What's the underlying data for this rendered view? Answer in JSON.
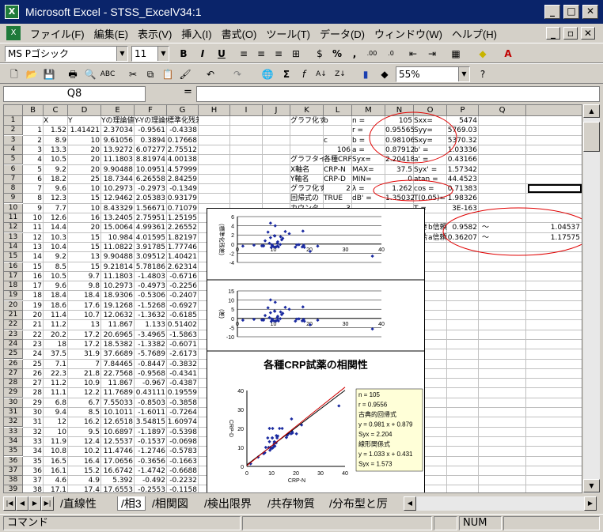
{
  "window": {
    "title": "Microsoft Excel - STSS_ExcelV34:1",
    "app_icon": "excel-icon"
  },
  "menu": [
    "ファイル(F)",
    "編集(E)",
    "表示(V)",
    "挿入(I)",
    "書式(O)",
    "ツール(T)",
    "データ(D)",
    "ウィンドウ(W)",
    "ヘルプ(H)"
  ],
  "format_toolbar": {
    "font": "MS Pゴシック",
    "size": "11"
  },
  "standard_toolbar": {
    "zoom": "55%"
  },
  "formula_bar": {
    "name_box": "Q8",
    "fx": "=",
    "value": ""
  },
  "columns": [
    "B",
    "C",
    "D",
    "E",
    "F",
    "G",
    "H",
    "I",
    "J",
    "K",
    "L",
    "M",
    "N",
    "O",
    "P",
    "Q"
  ],
  "rows": [
    [
      "",
      "X",
      "Y",
      "Yの理論値",
      "Y-Yの理論値",
      "標準化残差"
    ],
    [
      "1",
      "1.52",
      "1.41421",
      "2.37034",
      "-0.9561",
      "-0.4338"
    ],
    [
      "2",
      "8.9",
      "10",
      "9.61056",
      "0.3894",
      "0.17668"
    ],
    [
      "3",
      "13.3",
      "20",
      "13.9272",
      "6.07277",
      "2.75512"
    ],
    [
      "4",
      "10.5",
      "20",
      "11.1803",
      "8.81974",
      "4.00138"
    ],
    [
      "5",
      "9.2",
      "20",
      "9.90488",
      "10.0951",
      "4.57999"
    ],
    [
      "6",
      "18.2",
      "25",
      "18.7344",
      "6.26558",
      "2.84259"
    ],
    [
      "7",
      "9.6",
      "10",
      "10.2973",
      "-0.2973",
      "-0.1349"
    ],
    [
      "8",
      "12.3",
      "15",
      "12.9462",
      "2.05383",
      "0.93179"
    ],
    [
      "9",
      "7.7",
      "10",
      "8.43329",
      "1.56671",
      "0.71079"
    ],
    [
      "10",
      "12.6",
      "16",
      "13.2405",
      "2.75951",
      "1.25195"
    ],
    [
      "11",
      "14.4",
      "20",
      "15.0064",
      "4.99361",
      "2.26552"
    ],
    [
      "12",
      "10.3",
      "15",
      "10.984",
      "4.01595",
      "1.82197"
    ],
    [
      "13",
      "10.4",
      "15",
      "11.0822",
      "3.91785",
      "1.77746"
    ],
    [
      "14",
      "9.2",
      "13",
      "9.90488",
      "3.09512",
      "1.40421"
    ],
    [
      "15",
      "8.5",
      "15",
      "9.21814",
      "5.78186",
      "2.62314"
    ],
    [
      "16",
      "10.5",
      "9.7",
      "11.1803",
      "-1.4803",
      "-0.6716"
    ],
    [
      "17",
      "9.6",
      "9.8",
      "10.2973",
      "-0.4973",
      "-0.2256"
    ],
    [
      "18",
      "18.4",
      "18.4",
      "18.9306",
      "-0.5306",
      "-0.2407"
    ],
    [
      "19",
      "18.6",
      "17.6",
      "19.1268",
      "-1.5268",
      "-0.6927"
    ],
    [
      "20",
      "11.4",
      "10.7",
      "12.0632",
      "-1.3632",
      "-0.6185"
    ],
    [
      "21",
      "11.2",
      "13",
      "11.867",
      "1.133",
      "0.51402"
    ],
    [
      "22",
      "20.2",
      "17.2",
      "20.6965",
      "-3.4965",
      "-1.5863"
    ],
    [
      "23",
      "18",
      "17.2",
      "18.5382",
      "-1.3382",
      "-0.6071"
    ],
    [
      "24",
      "37.5",
      "31.9",
      "37.6689",
      "-5.7689",
      "-2.6173"
    ],
    [
      "25",
      "7.1",
      "7",
      "7.84465",
      "-0.8447",
      "-0.3832"
    ],
    [
      "26",
      "22.3",
      "21.8",
      "22.7568",
      "-0.9568",
      "-0.4341"
    ],
    [
      "27",
      "11.2",
      "10.9",
      "11.867",
      "-0.967",
      "-0.4387"
    ],
    [
      "28",
      "11.1",
      "12.2",
      "11.7689",
      "0.43111",
      "0.19559"
    ],
    [
      "29",
      "6.8",
      "6.7",
      "7.55033",
      "-0.8503",
      "-0.3858"
    ],
    [
      "30",
      "9.4",
      "8.5",
      "10.1011",
      "-1.6011",
      "-0.7264"
    ],
    [
      "31",
      "12",
      "16.2",
      "12.6518",
      "3.54815",
      "1.60974"
    ],
    [
      "32",
      "10",
      "9.5",
      "10.6897",
      "-1.1897",
      "-0.5398"
    ],
    [
      "33",
      "11.9",
      "12.4",
      "12.5537",
      "-0.1537",
      "-0.0698"
    ],
    [
      "34",
      "10.8",
      "10.2",
      "11.4746",
      "-1.2746",
      "-0.5783"
    ],
    [
      "35",
      "16.5",
      "16.4",
      "17.0656",
      "-0.3656",
      "-0.1663"
    ],
    [
      "36",
      "16.1",
      "15.2",
      "16.6742",
      "-1.4742",
      "-0.6688"
    ],
    [
      "37",
      "4.6",
      "4.9",
      "5.392",
      "-0.492",
      "-0.2232"
    ],
    [
      "38",
      "17.1",
      "17.4",
      "17.6553",
      "-0.2553",
      "-0.1158"
    ],
    [
      "39",
      "7.3",
      "7.2",
      "8.04087",
      "-0.8409",
      "-0.3815"
    ]
  ],
  "side": [
    {
      "row": 1,
      "J": "グラフ化す",
      "K": "b",
      "L": "n =",
      "M": "105",
      "N": "Sxx=",
      "O": "5474"
    },
    {
      "row": 2,
      "K": "",
      "L": "r =",
      "M": "0.95565",
      "N": "Syy=",
      "O": "5769.03"
    },
    {
      "row": 3,
      "K": "c",
      "L": "b =",
      "M": "0.98106",
      "N": "Sxy=",
      "O": "5370.32"
    },
    {
      "row": 4,
      "K": "106",
      "L": "a =",
      "M": "0.87912",
      "N": "b' =",
      "O": "1.03336"
    },
    {
      "row": 5,
      "J": "グラフタイ",
      "K": "各種CRF",
      "L": "Syx=",
      "M": "2.20418",
      "N": "a' =",
      "O": "0.43166"
    },
    {
      "row": 6,
      "J": "X軸名",
      "K": "CRP-N",
      "L": "MAX=",
      "M": "37.5",
      "N": "Syx' =",
      "O": "1.57342"
    },
    {
      "row": 7,
      "J": "Y軸名",
      "K": "CRP-D",
      "L": "MIN=",
      "M": "0",
      "N": "atan =",
      "O": "44.4523"
    },
    {
      "row": 8,
      "J": "グラフ化す",
      "K": "2",
      "L": "λ =",
      "M": "1.262",
      "N": "cos =",
      "O": "0.71383"
    },
    {
      "row": 9,
      "J": "回帰式の",
      "K": "TRUE",
      "L": "dB' =",
      "M": "1.35032",
      "N": "T(0.05)=",
      "O": "1.98326"
    },
    {
      "row": 10,
      "J": "カウンタ",
      "K": "3",
      "L": "",
      "M": "",
      "N": "T =",
      "O": "3E-163"
    }
  ],
  "ci": [
    {
      "label": "傾きb信頼",
      "value": "0.9582",
      "sep": "〜",
      "upper": "1.04537"
    },
    {
      "label": "切片a信頼",
      "value": "0.36207",
      "sep": "〜",
      "upper": "1.17575"
    }
  ],
  "chart_data": [
    {
      "type": "scatter",
      "ylabel": "(標準化残差)",
      "ylim": [
        -4,
        6
      ],
      "xlim": [
        0,
        40
      ],
      "yticks": [
        "6",
        "4",
        "2",
        "0",
        "-2",
        "-4"
      ],
      "xticks": [
        "0",
        "10",
        "20",
        "30",
        "40"
      ]
    },
    {
      "type": "scatter",
      "ylabel": "(差)",
      "ylim": [
        -10,
        15
      ],
      "xlim": [
        0,
        40
      ],
      "yticks": [
        "15",
        "10",
        "5",
        "0",
        "-5",
        "-10"
      ],
      "xticks": [
        "0",
        "10",
        "20",
        "30",
        "40"
      ]
    },
    {
      "type": "scatter",
      "title": "各種CRP試薬の相関性",
      "xlabel": "CRP-N",
      "ylabel": "CRP-D",
      "xlim": [
        0,
        40
      ],
      "ylim": [
        0,
        40
      ],
      "xticks": [
        "0",
        "10",
        "20",
        "30",
        "40"
      ],
      "yticks": [
        "40",
        "30",
        "20",
        "10",
        "0"
      ],
      "stats": [
        "n = 105",
        "r = 0.9556",
        "古典的回帰式",
        "y = 0.981 x + 0.879",
        "Syx = 2.204",
        "線形関係式",
        "y = 1.033 x + 0.431",
        "Syx = 1.573"
      ]
    }
  ],
  "tabs": [
    "直線性",
    "相3",
    "相関図",
    "検出限界",
    "共存物質",
    "分布型と厉"
  ],
  "status": {
    "left": "コマンド",
    "num": "NUM"
  }
}
